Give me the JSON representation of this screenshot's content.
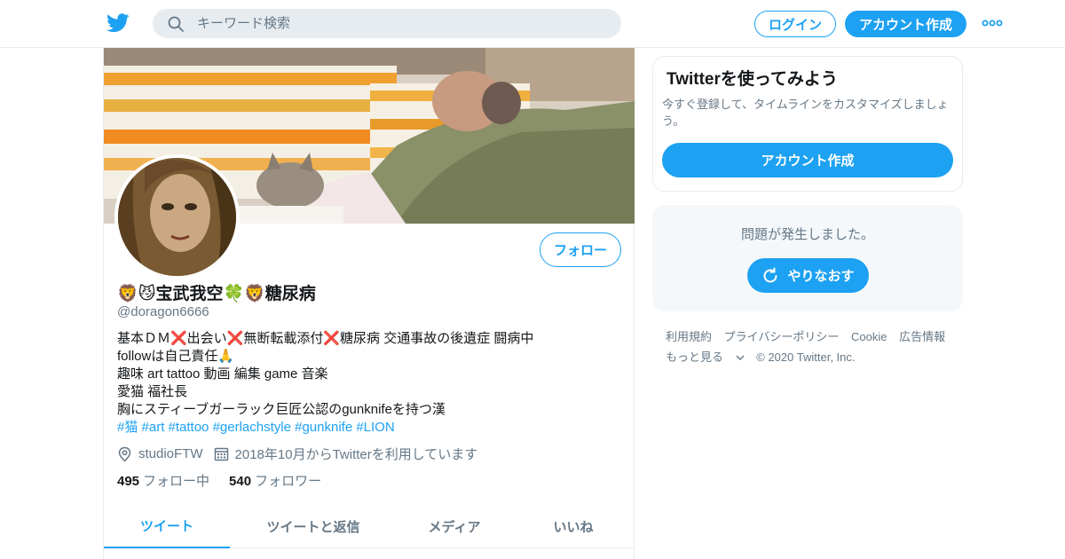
{
  "colors": {
    "accent": "#1da1f2",
    "muted": "#657786",
    "text": "#14171a",
    "border": "#e6ecf0"
  },
  "header": {
    "logo_icon": "twitter-bird-icon",
    "search_placeholder": "キーワード検索",
    "login_label": "ログイン",
    "signup_label": "アカウント作成",
    "more_icon": "more-dots-icon"
  },
  "profile": {
    "display_name": "🦁😼宝武我空🍀🦁糖尿病",
    "handle": "@doragon6666",
    "follow_label": "フォロー",
    "bio_lines": [
      "基本ＤＭ❌出会い❌無断転載添付❌糖尿病 交通事故の後遺症 闘病中",
      "followは自己責任🙏",
      "趣味 art tattoo 動画 編集 game 音楽",
      "愛猫 福社長",
      "胸にスティーブガーラック巨匠公認のgunknifeを持つ漢"
    ],
    "hashtags": "#猫 #art #tattoo #gerlachstyle #gunknife #LION",
    "location": "studioFTW",
    "joined": "2018年10月からTwitterを利用しています",
    "following_count": "495",
    "following_label": "フォロー中",
    "followers_count": "540",
    "followers_label": "フォロワー",
    "tabs": [
      "ツイート",
      "ツイートと返信",
      "メディア",
      "いいね"
    ]
  },
  "sidebar": {
    "promo_title": "Twitterを使ってみよう",
    "promo_text": "今すぐ登録して、タイムラインをカスタマイズしましょう。",
    "promo_button": "アカウント作成",
    "error_text": "問題が発生しました。",
    "retry_label": "やりなおす",
    "footer_links": [
      "利用規約",
      "プライバシーポリシー",
      "Cookie",
      "広告情報"
    ],
    "more_label": "もっと見る",
    "copyright": "© 2020 Twitter, Inc."
  }
}
